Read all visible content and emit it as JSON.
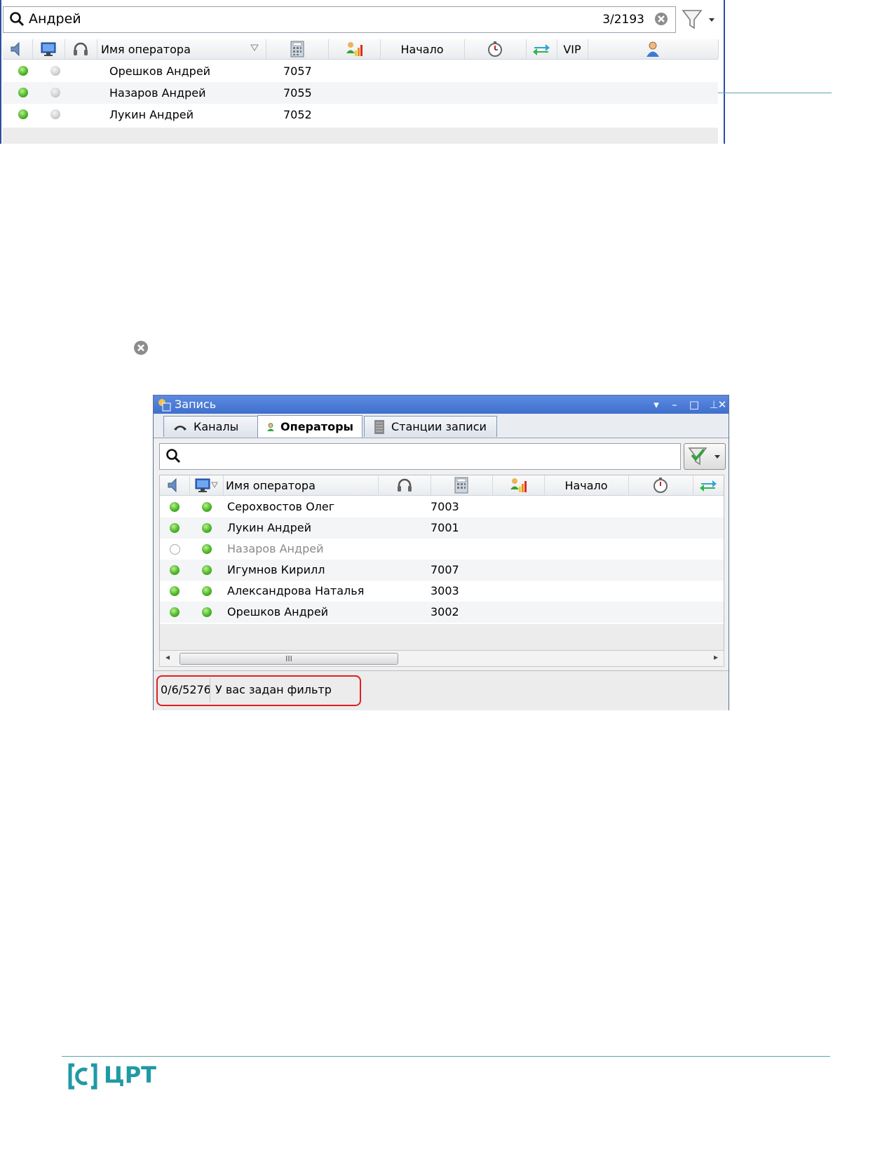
{
  "shot1": {
    "search_value": "Андрей",
    "search_count": "3/2193",
    "columns": {
      "name": "Имя оператора",
      "start": "Начало",
      "vip": "VIP"
    },
    "rows": [
      {
        "name": "Орешков Андрей",
        "number": "7057"
      },
      {
        "name": "Назаров Андрей",
        "number": "7055"
      },
      {
        "name": "Лукин Андрей",
        "number": "7052"
      }
    ]
  },
  "window": {
    "title": "Запись",
    "tabs": [
      "Каналы",
      "Операторы",
      "Станции записи"
    ],
    "columns": {
      "name": "Имя оператора",
      "start": "Начало"
    },
    "rows": [
      {
        "name": "Серохвостов Олег",
        "number": "7003",
        "status": "green"
      },
      {
        "name": "Лукин Андрей",
        "number": "7001",
        "status": "green"
      },
      {
        "name": "Назаров Андрей",
        "number": "",
        "status": "empty"
      },
      {
        "name": "Игумнов Кирилл",
        "number": "7007",
        "status": "green"
      },
      {
        "name": "Александрова Наталья",
        "number": "3003",
        "status": "green"
      },
      {
        "name": "Орешков Андрей",
        "number": "3002",
        "status": "green"
      }
    ],
    "scroll_thumb": "III",
    "status_count": "0/6/5276",
    "status_text": "У вас задан фильтр"
  },
  "logo": {
    "text": "ЦРТ"
  },
  "colors": {
    "accent": "#1f9aa5",
    "titlebar": "#3f6fcd",
    "highlight": "#e02020"
  }
}
